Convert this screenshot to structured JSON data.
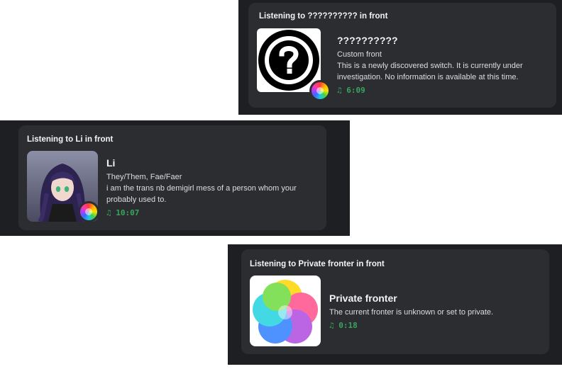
{
  "cards": [
    {
      "header": "Listening to ?????????? in front",
      "name": "??????????",
      "subtitle": "Custom front",
      "description_lines": [
        "This is a newly discovered switch. It is currently under",
        "investigation. No information is available at this time."
      ],
      "duration": "6:09",
      "art_icon": "question-mark-icon"
    },
    {
      "header": "Listening to Li in front",
      "name": "Li",
      "subtitle": "They/Them, Fae/Faer",
      "description_lines": [
        "i am the trans nb demigirl mess of a person whom your",
        "probably used to."
      ],
      "duration": "10:07",
      "art_icon": "avatar-image"
    },
    {
      "header": "Listening to Private fronter in front",
      "name": "Private fronter",
      "subtitle": "The current fronter is unknown or set to private.",
      "description_lines": [],
      "duration": "0:18",
      "art_icon": "color-circles-icon"
    }
  ],
  "music_glyph": "♫",
  "colors": {
    "panel_bg": "#1e1f22",
    "card_bg": "#2b2d31",
    "duration_green": "#3ba55d",
    "text": "#dbdee1"
  }
}
